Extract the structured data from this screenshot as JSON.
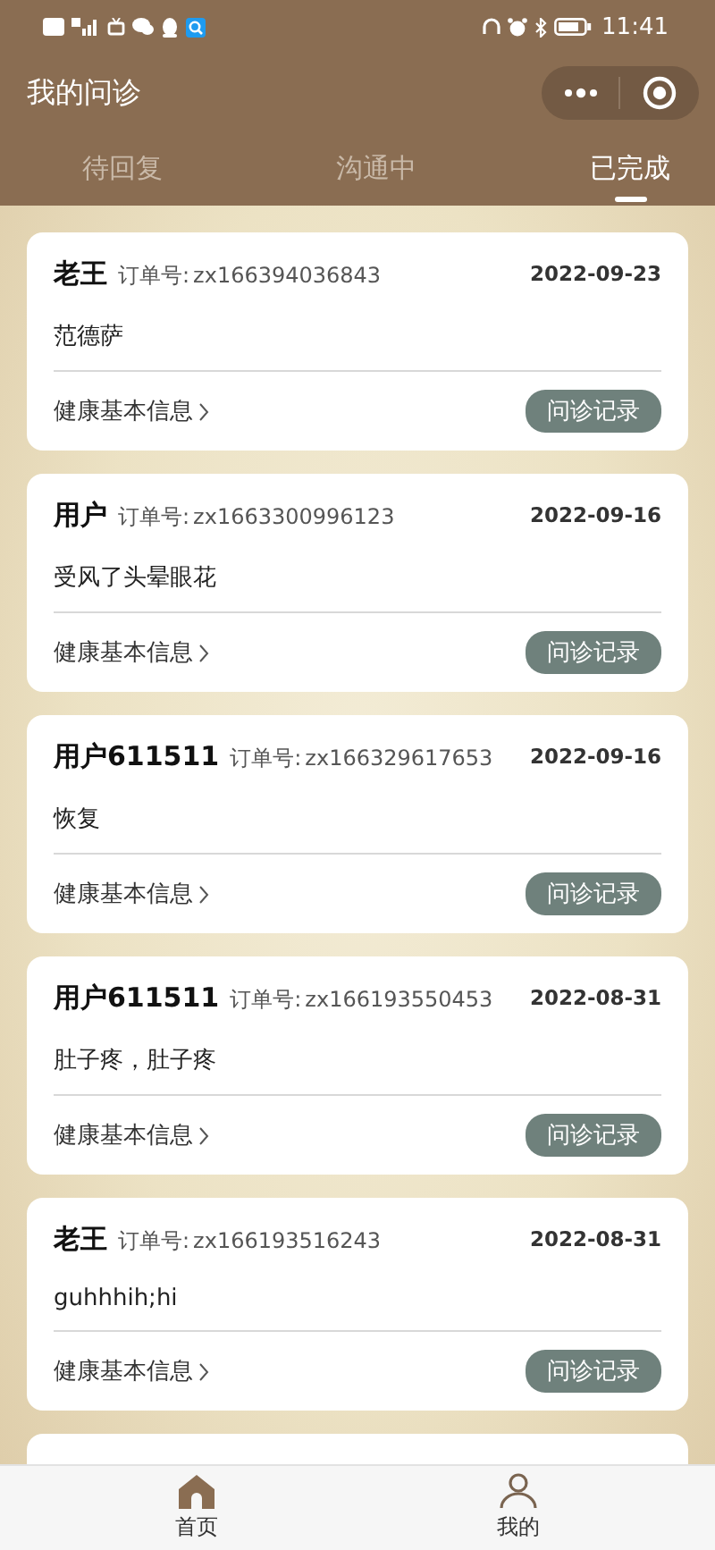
{
  "status_bar": {
    "time": "11:41"
  },
  "title_bar": {
    "title": "我的问诊"
  },
  "tabs": [
    {
      "label": "待回复",
      "selected": false
    },
    {
      "label": "沟通中",
      "selected": false
    },
    {
      "label": "已完成",
      "selected": true
    }
  ],
  "orders": [
    {
      "name": "老王",
      "order_label": "订单号:",
      "order_no": "zx166394036843",
      "date": "2022-09-23",
      "complaint": "范德萨",
      "info_link": "健康基本信息",
      "action": "问诊记录"
    },
    {
      "name": "用户",
      "order_label": "订单号:",
      "order_no": "zx1663300996123",
      "date": "2022-09-16",
      "complaint": "受风了头晕眼花",
      "info_link": "健康基本信息",
      "action": "问诊记录"
    },
    {
      "name": "用户611511",
      "order_label": "订单号:",
      "order_no": "zx166329617653",
      "date": "2022-09-16",
      "complaint": "恢复",
      "info_link": "健康基本信息",
      "action": "问诊记录"
    },
    {
      "name": "用户611511",
      "order_label": "订单号:",
      "order_no": "zx166193550453",
      "date": "2022-08-31",
      "complaint": "肚子疼，肚子疼",
      "info_link": "健康基本信息",
      "action": "问诊记录"
    },
    {
      "name": "老王",
      "order_label": "订单号:",
      "order_no": "zx166193516243",
      "date": "2022-08-31",
      "complaint": "guhhhih;hi",
      "info_link": "健康基本信息",
      "action": "问诊记录"
    }
  ],
  "bottom_nav": [
    {
      "label": "首页",
      "kind": "home",
      "selected": true
    },
    {
      "label": "我的",
      "kind": "person",
      "selected": false
    }
  ]
}
